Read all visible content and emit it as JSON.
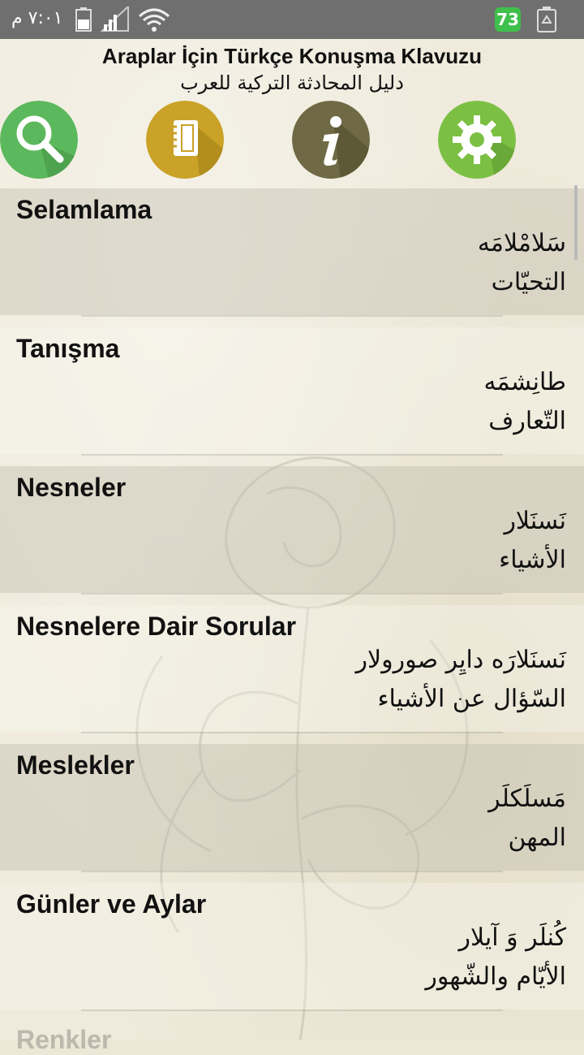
{
  "status_bar": {
    "time": "٧:٠١ م",
    "battery_percent": "73",
    "icons": [
      "sim-icon",
      "signal-icon",
      "wifi-icon",
      "recycle-icon"
    ]
  },
  "header": {
    "title": "Araplar İçin Türkçe Konuşma Klavuzu",
    "subtitle": "دليل المحادثة التركية للعرب"
  },
  "toolbar": {
    "buttons": [
      {
        "icon": "search-icon",
        "color": "#5cb85c"
      },
      {
        "icon": "notebook-icon",
        "color": "#c9a227"
      },
      {
        "icon": "info-icon",
        "color": "#6f6a45"
      },
      {
        "icon": "settings-icon",
        "color": "#7bc043"
      }
    ]
  },
  "categories": [
    {
      "title": "Selamlama",
      "transliteration": "سَلامْلامَه",
      "arabic": "التحيّات"
    },
    {
      "title": "Tanışma",
      "transliteration": "طانِشمَه",
      "arabic": "التّعارف"
    },
    {
      "title": "Nesneler",
      "transliteration": "نَسنَلار",
      "arabic": "الأشياء"
    },
    {
      "title": "Nesnelere Dair Sorular",
      "transliteration": "نَسنَلارَه دايِر صورولار",
      "arabic": "السّؤال عن الأشياء"
    },
    {
      "title": "Meslekler",
      "transliteration": "مَسلَكلَر",
      "arabic": "المهن"
    },
    {
      "title": "Günler ve Aylar",
      "transliteration": "كُنلَر وَ آيلار",
      "arabic": "الأيّام والشّهور"
    }
  ],
  "next_partial_title": "Renkler"
}
